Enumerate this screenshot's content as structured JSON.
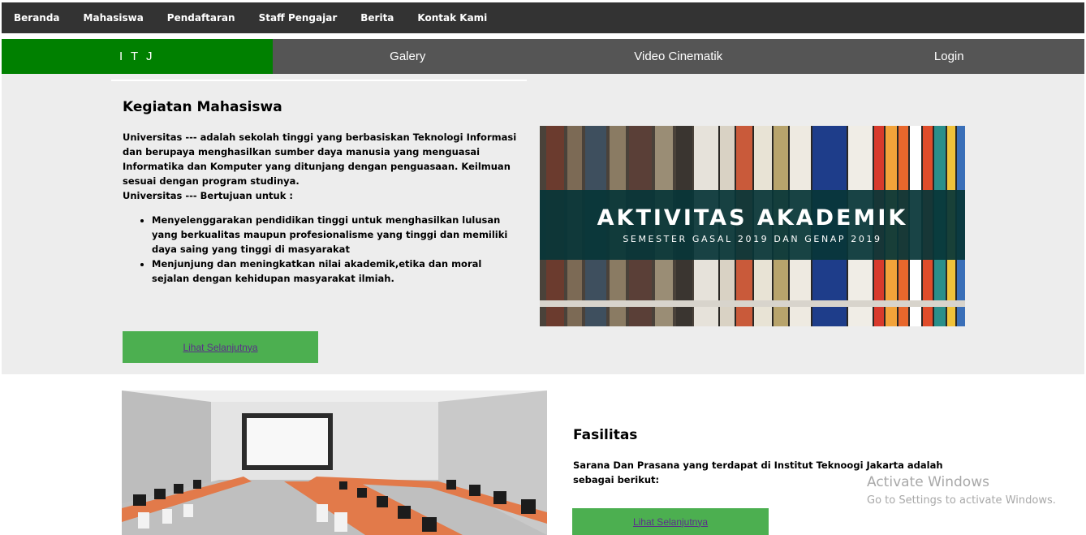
{
  "topnav": {
    "items": [
      "Beranda",
      "Mahasiswa",
      "Pendaftaran",
      "Staff Pengajar",
      "Berita",
      "Kontak Kami"
    ]
  },
  "tabs": {
    "items": [
      "I T J",
      "Galery",
      "Video Cinematik",
      "Login"
    ],
    "active_color": "#008000"
  },
  "kegiatan": {
    "title": "Kegiatan Mahasiswa",
    "paragraph": "Universitas --- adalah sekolah tinggi yang berbasiskan Teknologi Informasi dan berupaya menghasilkan sumber daya manusia yang menguasai Informatika dan Komputer yang ditunjang dengan penguasaan. Keilmuan sesuai dengan program studinya.",
    "purpose_intro": "Universitas --- Bertujuan untuk :",
    "goals": [
      "Menyelenggarakan pendidikan tinggi untuk menghasilkan lulusan yang berkualitas maupun profesionalisme yang tinggi dan memiliki daya saing yang tinggi di masyarakat",
      "Menjunjung dan meningkatkan nilai akademik,etika dan moral sejalan dengan kehidupan masyarakat ilmiah."
    ],
    "button_label": "Lihat Selanjutnya",
    "banner": {
      "title": "AKTIVITAS AKADEMIK",
      "subtitle": "SEMESTER GASAL 2019 DAN GENAP 2019"
    }
  },
  "fasilitas": {
    "title": "Fasilitas",
    "text": "Sarana Dan Prasana yang terdapat di Institut Teknoogi Jakarta adalah sebagai berikut:",
    "button_label": "Lihat Selanjutnya"
  },
  "watermark": {
    "line1": "Activate Windows",
    "line2": "Go to Settings to activate Windows."
  },
  "colors": {
    "topnav_bg": "#333333",
    "tabbar_bg": "#555555",
    "button_bg": "#4caf50",
    "section_bg": "#ededed"
  }
}
